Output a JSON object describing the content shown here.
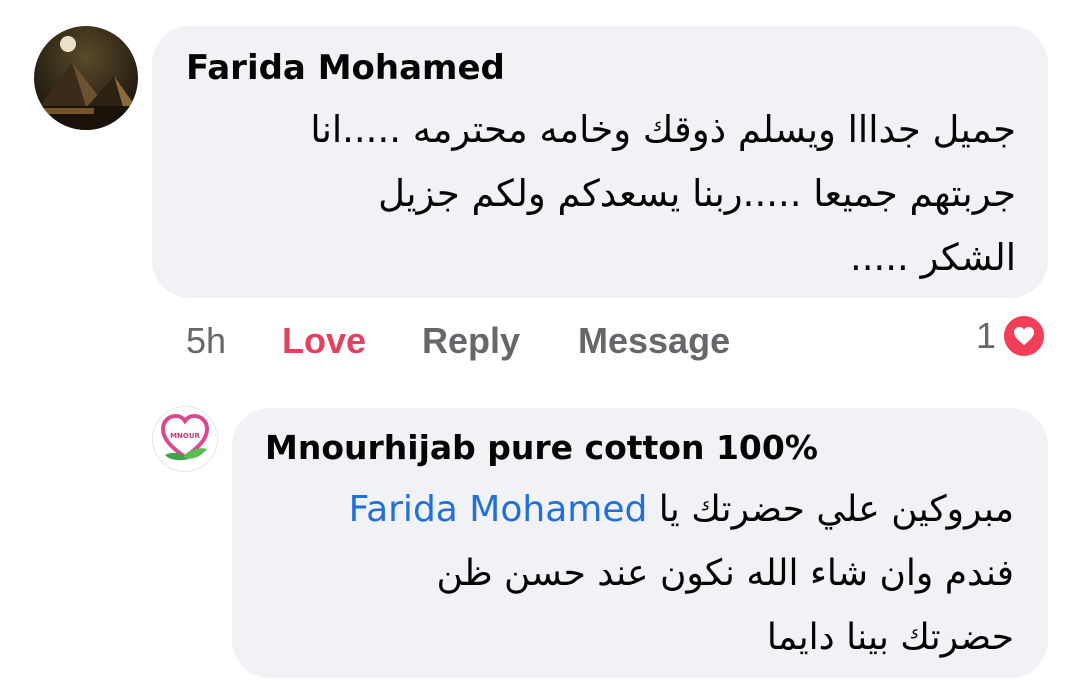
{
  "comment": {
    "author": "Farida Mohamed",
    "lines": [
      "جميل جدااا ويسلم ذوقك وخامه  محترمه .....انا",
      "جربتهم جميعا .....ربنا يسعدكم ولكم جزيل",
      "الشكر ....."
    ],
    "time": "5h",
    "love_label": "Love",
    "reply_label": "Reply",
    "message_label": "Message",
    "reaction_count": "1",
    "reaction_icon": "heart-icon",
    "colors": {
      "love": "#e4405f",
      "heart": "#f33e58",
      "bubble": "#f0f2f5"
    }
  },
  "reply": {
    "author": "Mnourhijab pure cotton 100%",
    "avatar_label": "MNOUR",
    "mention": "Farida Mohamed",
    "line1_text": "مبروكين علي حضرتك يا",
    "line2": "فندم وان شاء الله نكون عند حسن ظن",
    "line3": "حضرتك بينا دايما",
    "colors": {
      "mention": "#216fdb"
    }
  }
}
